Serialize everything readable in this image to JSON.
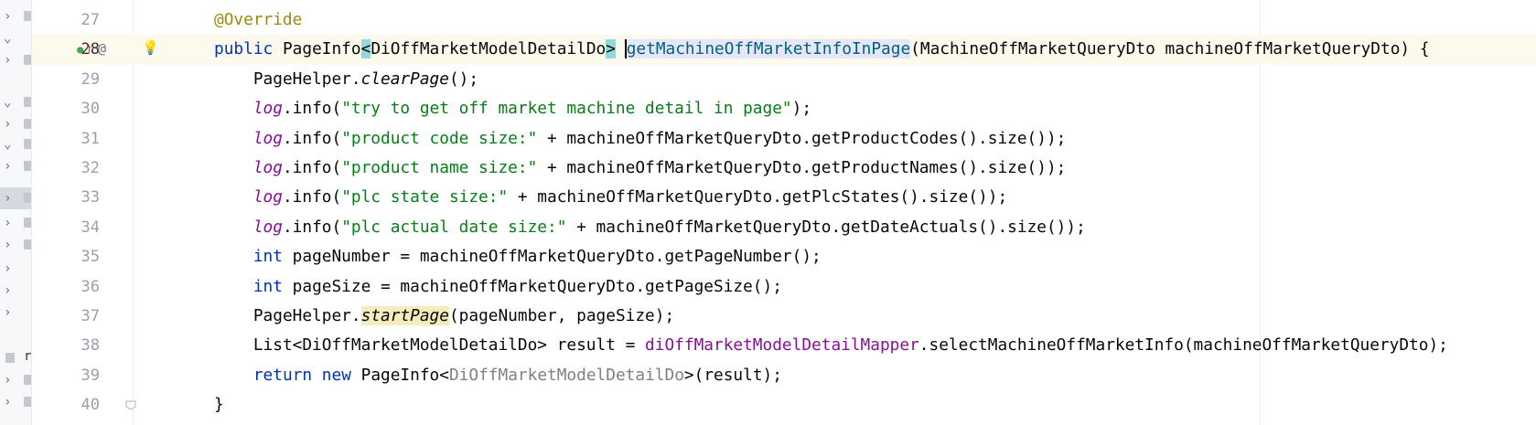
{
  "editor": {
    "current_line": "28",
    "gutter_icons": {
      "implements": "implements-method-icon",
      "annotation_symbol": "@",
      "intention": "bulb-icon"
    },
    "lines": [
      {
        "num": "27"
      },
      {
        "num": "28"
      },
      {
        "num": "29"
      },
      {
        "num": "30"
      },
      {
        "num": "31"
      },
      {
        "num": "32"
      },
      {
        "num": "33"
      },
      {
        "num": "34"
      },
      {
        "num": "35"
      },
      {
        "num": "36"
      },
      {
        "num": "37"
      },
      {
        "num": "38"
      },
      {
        "num": "39"
      },
      {
        "num": "40"
      }
    ],
    "tokens": {
      "l27_ann": "@Override",
      "l28_public": "public",
      "l28_type": "PageInfo",
      "l28_lt": "<",
      "l28_generic": "DiOffMarketModelDetailDo",
      "l28_gt": ">",
      "l28_method": "getMachineOffMarketInfoInPage",
      "l28_params": "(MachineOffMarketQueryDto machineOffMarketQueryDto) {",
      "l29_cls": "PageHelper.",
      "l29_call": "clearPage",
      "l29_rest": "();",
      "log": "log",
      "info_open": ".info(",
      "l30_str": "\"try to get off market machine detail in page\"",
      "l30_rest": ");",
      "l31_str": "\"product code size:\"",
      "l31_rest": " + machineOffMarketQueryDto.getProductCodes().size());",
      "l32_str": "\"product name size:\"",
      "l32_rest": " + machineOffMarketQueryDto.getProductNames().size());",
      "l33_str": "\"plc state size:\"",
      "l33_rest": " + machineOffMarketQueryDto.getPlcStates().size());",
      "l34_str": "\"plc actual date size:\"",
      "l34_rest": " + machineOffMarketQueryDto.getDateActuals().size());",
      "int": "int",
      "l35_rest": " pageNumber = machineOffMarketQueryDto.getPageNumber();",
      "l36_rest": " pageSize = machineOffMarketQueryDto.getPageSize();",
      "l37_cls": "PageHelper.",
      "l37_call": "startPage",
      "l37_rest": "(pageNumber, pageSize);",
      "l38_head": "List<DiOffMarketModelDetailDo> result = ",
      "l38_field": "diOffMarketModelDetailMapper",
      "l38_rest": ".selectMachineOffMarketInfo(machineOffMarketQueryDto);",
      "l39_return": "return",
      "l39_new": "new",
      "l39_type": " PageInfo<",
      "l39_generic": "DiOffMarketModelDetailDo",
      "l39_rest": ">(result);",
      "l40_brace": "}"
    }
  },
  "project_tree": {
    "visible_label": "r"
  }
}
